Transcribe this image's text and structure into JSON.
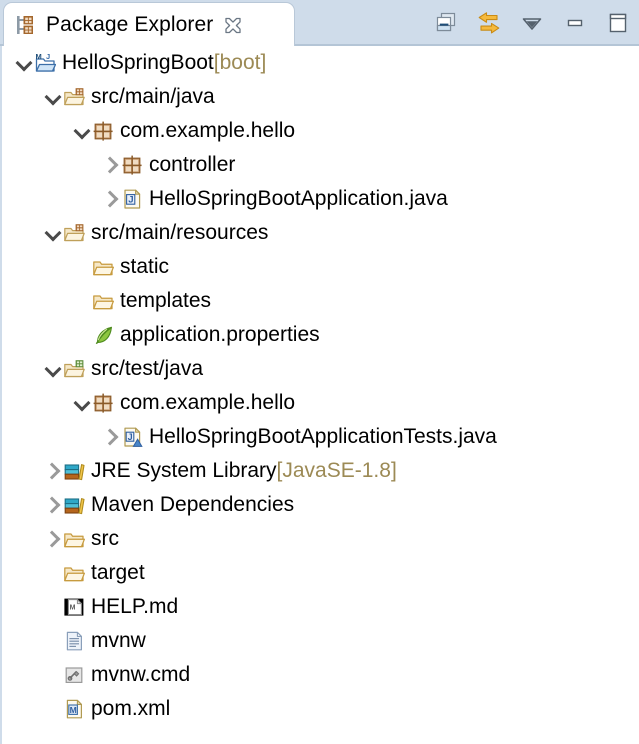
{
  "tab": {
    "title": "Package Explorer",
    "icon": "package-explorer-icon",
    "close_icon": "close-icon"
  },
  "toolbar": {
    "buttons": [
      {
        "name": "collapse-all-button",
        "icon": "collapse-all-icon",
        "tooltip": "Collapse All"
      },
      {
        "name": "link-with-editor-button",
        "icon": "link-with-editor-icon",
        "tooltip": "Link with Editor"
      },
      {
        "name": "view-menu-button",
        "icon": "chevron-down-icon",
        "tooltip": "View Menu"
      },
      {
        "name": "minimize-button",
        "icon": "minimize-icon",
        "tooltip": "Minimize"
      },
      {
        "name": "maximize-button",
        "icon": "maximize-icon",
        "tooltip": "Maximize"
      }
    ]
  },
  "colors": {
    "tab_bar_bg": "#cfdcea",
    "tab_bg": "#ffffff",
    "tree_bg": "#ffffff",
    "text": "#000000",
    "suffix_text": "#9c8a55",
    "twisty_expanded": "#4a4a4a",
    "twisty_collapsed": "#9a9a9a"
  },
  "tree": {
    "rows": [
      {
        "label": "HelloSpringBoot",
        "suffix": " [boot]",
        "indent": 0,
        "state": "expanded",
        "icon": "maven-java-project-icon",
        "name": "tree-item-project"
      },
      {
        "label": "src/main/java",
        "suffix": "",
        "indent": 1,
        "state": "expanded",
        "icon": "source-folder-icon",
        "name": "tree-item-src-main-java"
      },
      {
        "label": "com.example.hello",
        "suffix": "",
        "indent": 2,
        "state": "expanded",
        "icon": "package-icon",
        "name": "tree-item-package-main"
      },
      {
        "label": "controller",
        "suffix": "",
        "indent": 3,
        "state": "collapsed",
        "icon": "package-icon",
        "name": "tree-item-package-controller"
      },
      {
        "label": "HelloSpringBootApplication.java",
        "suffix": "",
        "indent": 3,
        "state": "collapsed",
        "icon": "java-file-icon",
        "name": "tree-item-java-application"
      },
      {
        "label": "src/main/resources",
        "suffix": "",
        "indent": 1,
        "state": "expanded",
        "icon": "source-folder-icon",
        "name": "tree-item-src-main-resources"
      },
      {
        "label": "static",
        "suffix": "",
        "indent": 2,
        "state": "leaf",
        "icon": "folder-icon",
        "name": "tree-item-folder-static"
      },
      {
        "label": "templates",
        "suffix": "",
        "indent": 2,
        "state": "leaf",
        "icon": "folder-icon",
        "name": "tree-item-folder-templates"
      },
      {
        "label": "application.properties",
        "suffix": "",
        "indent": 2,
        "state": "leaf",
        "icon": "spring-leaf-icon",
        "name": "tree-item-application-properties"
      },
      {
        "label": "src/test/java",
        "suffix": "",
        "indent": 1,
        "state": "expanded",
        "icon": "test-source-folder-icon",
        "name": "tree-item-src-test-java"
      },
      {
        "label": "com.example.hello",
        "suffix": "",
        "indent": 2,
        "state": "expanded",
        "icon": "package-icon",
        "name": "tree-item-package-test"
      },
      {
        "label": "HelloSpringBootApplicationTests.java",
        "suffix": "",
        "indent": 3,
        "state": "collapsed",
        "icon": "junit-test-file-icon",
        "name": "tree-item-java-application-tests"
      },
      {
        "label": "JRE System Library",
        "suffix": " [JavaSE-1.8]",
        "indent": 1,
        "state": "collapsed",
        "icon": "library-icon",
        "name": "tree-item-jre-system-library"
      },
      {
        "label": "Maven Dependencies",
        "suffix": "",
        "indent": 1,
        "state": "collapsed",
        "icon": "library-icon",
        "name": "tree-item-maven-dependencies"
      },
      {
        "label": "src",
        "suffix": "",
        "indent": 1,
        "state": "collapsed",
        "icon": "folder-icon",
        "name": "tree-item-folder-src"
      },
      {
        "label": "target",
        "suffix": "",
        "indent": 1,
        "state": "leaf",
        "icon": "folder-icon",
        "name": "tree-item-folder-target"
      },
      {
        "label": "HELP.md",
        "suffix": "",
        "indent": 1,
        "state": "leaf",
        "icon": "markdown-file-icon",
        "name": "tree-item-help-md"
      },
      {
        "label": "mvnw",
        "suffix": "",
        "indent": 1,
        "state": "leaf",
        "icon": "text-file-icon",
        "name": "tree-item-mvnw"
      },
      {
        "label": "mvnw.cmd",
        "suffix": "",
        "indent": 1,
        "state": "leaf",
        "icon": "script-file-icon",
        "name": "tree-item-mvnw-cmd"
      },
      {
        "label": "pom.xml",
        "suffix": "",
        "indent": 1,
        "state": "leaf",
        "icon": "maven-pom-file-icon",
        "name": "tree-item-pom-xml"
      }
    ]
  }
}
